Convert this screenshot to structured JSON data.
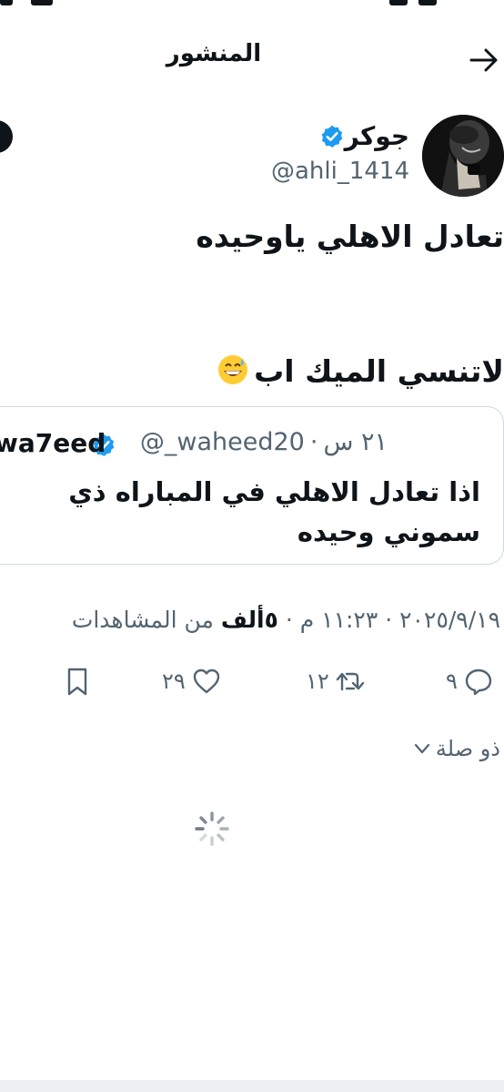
{
  "header": {
    "title": "المنشور",
    "back_icon": "arrow-right-icon"
  },
  "author": {
    "name": "جوكر",
    "handle": "@ahli_1414",
    "verified_color": "#1d9bf0"
  },
  "post": {
    "line1": "تعادل الاهلي ياوحيده",
    "line2": "لاتنسي الميك اب",
    "emoji": "grinning-sweat-emoji"
  },
  "quote": {
    "name": "wa7eed",
    "handle": "@_waheed20",
    "time": "٢١ س",
    "separator": "·",
    "text": "اذا تعادل الاهلي في المباراه ذي سموني وحيده"
  },
  "meta": {
    "date": "٢٠٢٥/٩/١٩",
    "time": "١١:٢٣ م",
    "views_count": "٥ألف",
    "views_label": "من المشاهدات",
    "dot": "·"
  },
  "actions": {
    "replies": "٩",
    "reposts": "١٢",
    "likes": "٢٩"
  },
  "related": {
    "label": "ذو صلة"
  },
  "colors": {
    "text": "#0f1419",
    "muted": "#536471",
    "accent": "#1d9bf0",
    "border": "#cfd9de"
  }
}
